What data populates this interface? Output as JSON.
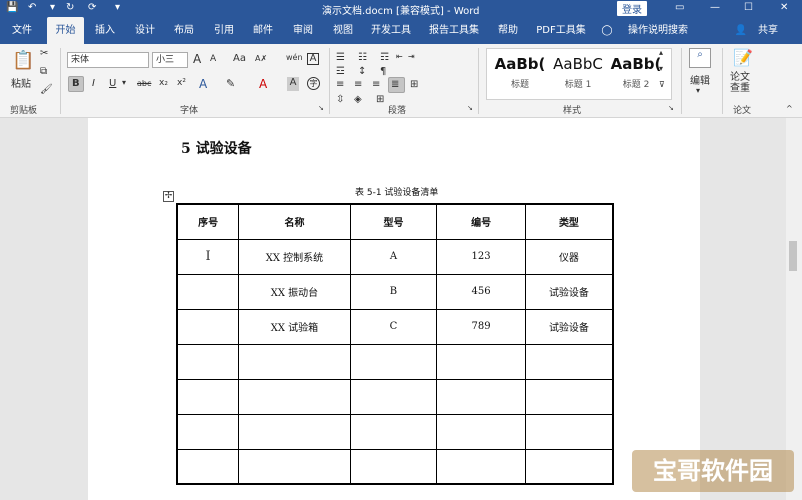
{
  "window": {
    "title": "演示文档.docm [兼容模式]  -  Word",
    "login_label": "登录"
  },
  "tabs": [
    "文件",
    "开始",
    "插入",
    "设计",
    "布局",
    "引用",
    "邮件",
    "审阅",
    "视图",
    "开发工具",
    "报告工具集",
    "帮助",
    "PDF工具集",
    "操作说明搜索"
  ],
  "share_label": "共享",
  "ribbon": {
    "clipboard": {
      "paste_label": "粘贴",
      "group_label": "剪贴板"
    },
    "font": {
      "font_name": "宋体",
      "font_size": "小三",
      "size_grow": "A",
      "size_shrink": "A",
      "case_label": "Aa",
      "wen_label": "wén",
      "bold": "B",
      "italic": "I",
      "underline": "U",
      "strike": "abc",
      "subscript": "x₂",
      "superscript": "x²",
      "group_label": "字体"
    },
    "paragraph": {
      "group_label": "段落"
    },
    "styles": {
      "items": [
        {
          "preview": "AaBb(",
          "name": "标题"
        },
        {
          "preview": "AaBbC",
          "name": "标题 1"
        },
        {
          "preview": "AaBb(",
          "name": "标题 2"
        }
      ],
      "group_label": "样式"
    },
    "edit": {
      "label": "编辑"
    },
    "paper": {
      "label": "论文\n查重",
      "group_label": "论文"
    }
  },
  "document": {
    "heading": "5  试验设备",
    "caption": "表 5-1    试验设备清单",
    "table_headers": [
      "序号",
      "名称",
      "型号",
      "编号",
      "类型"
    ],
    "table_rows": [
      [
        "",
        "XX 控制系统",
        "A",
        "123",
        "仪器"
      ],
      [
        "",
        "XX 振动台",
        "B",
        "456",
        "试验设备"
      ],
      [
        "",
        "XX 试验箱",
        "C",
        "789",
        "试验设备"
      ],
      [
        "",
        "",
        "",
        "",
        ""
      ],
      [
        "",
        "",
        "",
        "",
        ""
      ],
      [
        "",
        "",
        "",
        "",
        ""
      ],
      [
        "",
        "",
        "",
        "",
        ""
      ]
    ]
  },
  "watermark": "宝哥软件园",
  "colors": {
    "accent": "#2b579a",
    "ribbon_bg": "#f3f3f3"
  }
}
